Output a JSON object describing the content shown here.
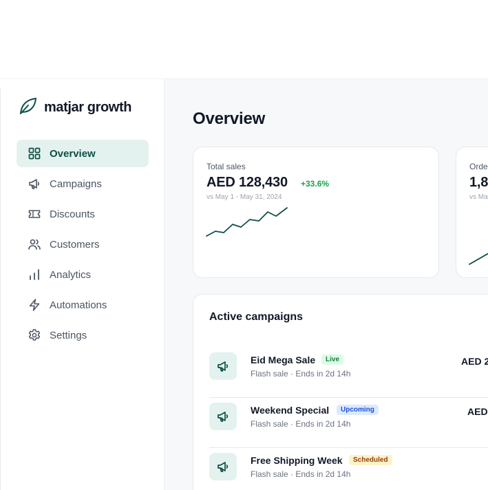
{
  "brand": {
    "name": "matjar growth",
    "icon": "leaf-icon",
    "color": "#0b4f46"
  },
  "sidebar": {
    "items": [
      {
        "label": "Overview",
        "icon": "grid-icon",
        "active": true
      },
      {
        "label": "Campaigns",
        "icon": "megaphone-icon"
      },
      {
        "label": "Discounts",
        "icon": "ticket-icon"
      },
      {
        "label": "Customers",
        "icon": "users-icon"
      },
      {
        "label": "Analytics",
        "icon": "bar-chart-icon"
      },
      {
        "label": "Automations",
        "icon": "lightning-icon"
      },
      {
        "label": "Settings",
        "icon": "gear-icon"
      }
    ]
  },
  "main": {
    "title": "Overview",
    "stats": [
      {
        "label": "Total sales",
        "value": "AED 128,430",
        "delta": "+33.6%",
        "period": "vs May 1 - May 31, 2024"
      },
      {
        "label": "Orde",
        "value": "1,8",
        "period": "vs Ma"
      }
    ],
    "campaigns": {
      "title": "Active campaigns",
      "rows": [
        {
          "name": "Eid Mega Sale",
          "badge": "Live",
          "meta": "Flash sale · Ends in 2d 14h",
          "amount": "AED 2"
        },
        {
          "name": "Weekend Special",
          "badge": "Upcoming",
          "meta": "Flash sale · Ends in 2d 14h",
          "amount": "AED"
        },
        {
          "name": "Free Shipping Week",
          "badge": "Scheduled",
          "meta": "Flash sale · Ends in 2d 14h",
          "amount": ""
        }
      ]
    }
  },
  "colors": {
    "accent": "#0b4f46",
    "accent_bg": "#e4f2ef",
    "positive": "#16a34a"
  }
}
